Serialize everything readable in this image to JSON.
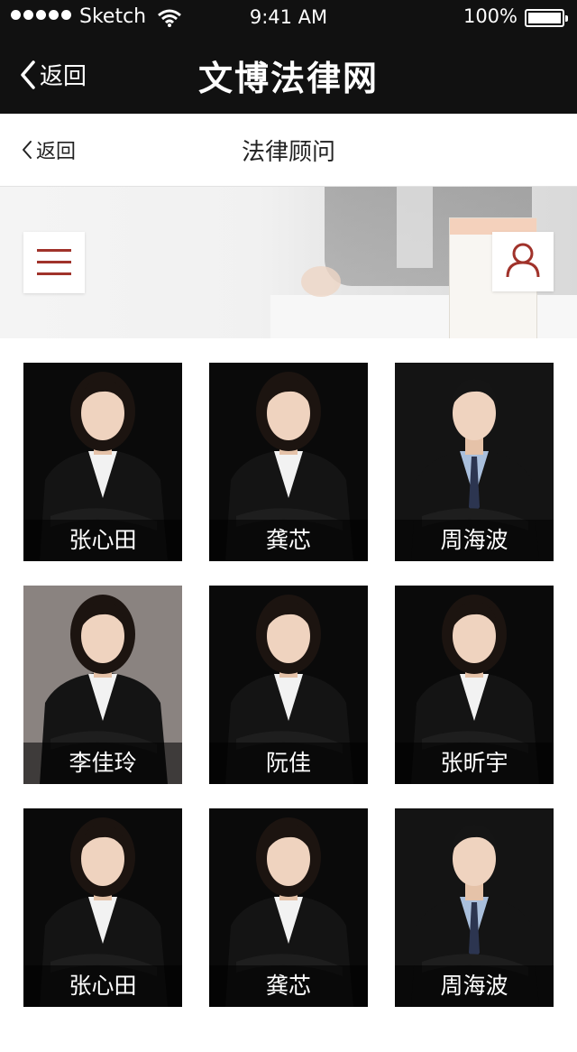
{
  "status_bar": {
    "carrier": "Sketch",
    "time": "9:41 AM",
    "battery": "100%",
    "battery_level": 1.0
  },
  "app_header": {
    "back_label": "返回",
    "title": "文博法律网"
  },
  "sub_header": {
    "back_label": "返回",
    "title": "法律顾问"
  },
  "banner": {
    "menu_icon": "hamburger-menu-icon",
    "user_icon": "user-icon",
    "accent_color": "#a0322a"
  },
  "lawyers": [
    {
      "name": "张心田",
      "gender": "female",
      "bg": "#0a0a0a"
    },
    {
      "name": "龚芯",
      "gender": "female",
      "bg": "#0a0a0a"
    },
    {
      "name": "周海波",
      "gender": "male",
      "bg": "#141414"
    },
    {
      "name": "李佳玲",
      "gender": "female",
      "bg": "#8a8380"
    },
    {
      "name": "阮佳",
      "gender": "female",
      "bg": "#0a0a0a"
    },
    {
      "name": "张昕宇",
      "gender": "female",
      "bg": "#0a0a0a"
    },
    {
      "name": "张心田",
      "gender": "female",
      "bg": "#0a0a0a"
    },
    {
      "name": "龚芯",
      "gender": "female",
      "bg": "#0a0a0a"
    },
    {
      "name": "周海波",
      "gender": "male",
      "bg": "#141414"
    }
  ]
}
